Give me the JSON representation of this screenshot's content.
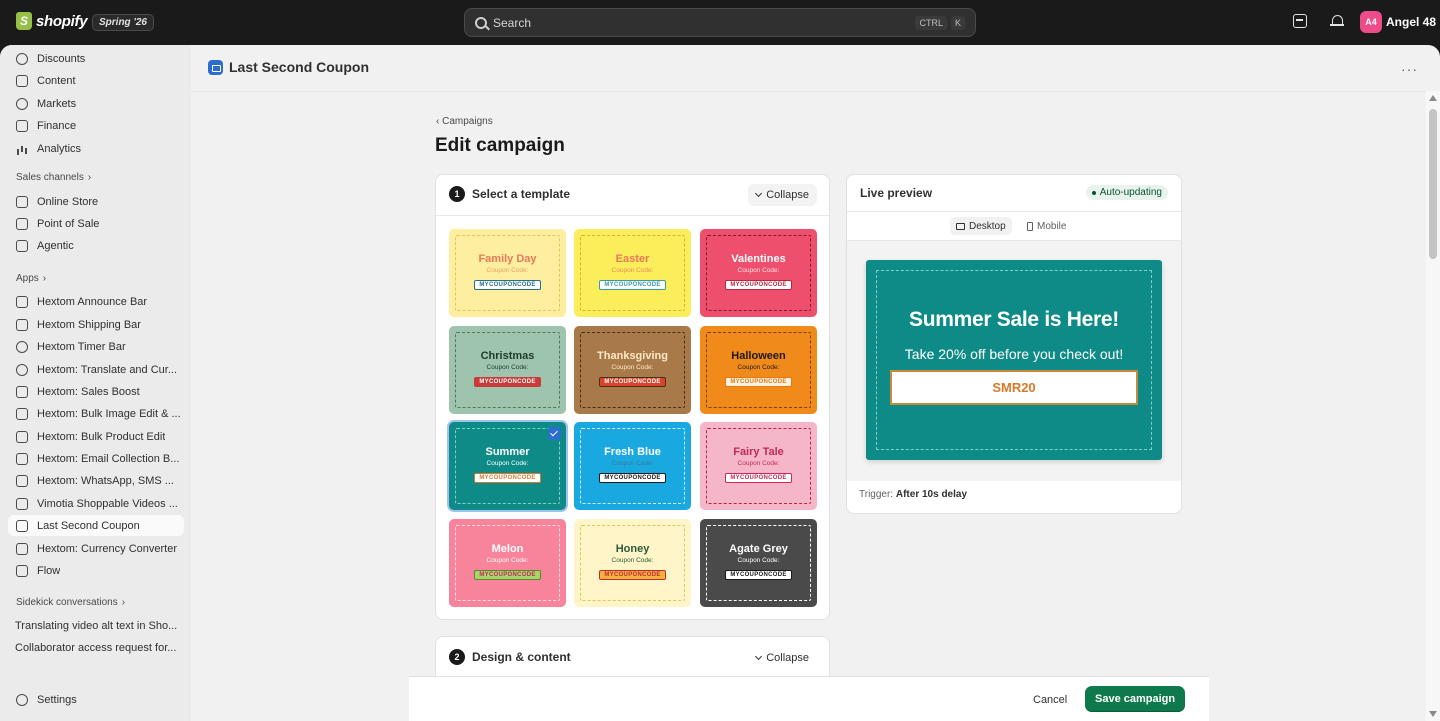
{
  "topbar": {
    "logo_text": "shopify",
    "edition_badge": "Spring '26",
    "search_placeholder": "Search",
    "shortcut_ctrl": "CTRL",
    "shortcut_key": "K",
    "avatar_initials": "A4",
    "user_name": "Angel 48",
    "avatar_color": "#ed4b8a"
  },
  "sidebar": {
    "top_items": [
      {
        "label": "Discounts",
        "icon": "discount-icon"
      },
      {
        "label": "Content",
        "icon": "content-icon"
      },
      {
        "label": "Markets",
        "icon": "globe-icon"
      },
      {
        "label": "Finance",
        "icon": "bank-icon"
      },
      {
        "label": "Analytics",
        "icon": "chart-icon"
      }
    ],
    "sales_channels_label": "Sales channels",
    "sales_channels": [
      {
        "label": "Online Store",
        "icon": "store-icon"
      },
      {
        "label": "Point of Sale",
        "icon": "pos-icon"
      },
      {
        "label": "Agentic",
        "icon": "agentic-icon"
      }
    ],
    "apps_label": "Apps",
    "apps": [
      {
        "label": "Hextom Announce Bar"
      },
      {
        "label": "Hextom Shipping Bar"
      },
      {
        "label": "Hextom Timer Bar"
      },
      {
        "label": "Hextom: Translate and Cur..."
      },
      {
        "label": "Hextom: Sales Boost"
      },
      {
        "label": "Hextom: Bulk Image Edit & ..."
      },
      {
        "label": "Hextom: Bulk Product Edit"
      },
      {
        "label": "Hextom: Email Collection B..."
      },
      {
        "label": "Hextom: WhatsApp, SMS ..."
      },
      {
        "label": "Vimotia Shoppable Videos ..."
      },
      {
        "label": "Last Second Coupon"
      },
      {
        "label": "Hextom: Currency Converter"
      },
      {
        "label": "Flow"
      }
    ],
    "sidekick_label": "Sidekick conversations",
    "sidekick": [
      "Translating video alt text in Sho...",
      "Collaborator access request for..."
    ],
    "settings_label": "Settings"
  },
  "page": {
    "app_title": "Last Second Coupon",
    "more_actions": "···",
    "breadcrumb": "Campaigns",
    "heading": "Edit campaign"
  },
  "template_section": {
    "step": "1",
    "title": "Select a template",
    "collapse_label": "Collapse",
    "templates": [
      {
        "name": "Family Day",
        "sub": "Coupon Code:",
        "code": "MYCOUPONCODE",
        "bg": "#fdeea0",
        "border": "#e0c65a",
        "name_color": "#e8795a",
        "sub_color": "#e8a26a",
        "code_bg": "#ffffff",
        "code_color": "#2a6f8a",
        "code_border": "#2a6f8a"
      },
      {
        "name": "Easter",
        "sub": "Coupon Code:",
        "code": "MYCOUPONCODE",
        "bg": "#fbee5a",
        "border": "#c9b830",
        "name_color": "#e8795a",
        "sub_color": "#e88e5a",
        "code_bg": "#ffffff",
        "code_color": "#3a9aa8",
        "code_border": "#3a9aa8"
      },
      {
        "name": "Valentines",
        "sub": "Coupon Code:",
        "code": "MYCOUPONCODE",
        "bg": "#ee4f6c",
        "border": "#7a1e2e",
        "name_color": "#ffffff",
        "sub_color": "#ffe0e6",
        "code_bg": "#ffffff",
        "code_color": "#b5283f",
        "code_border": "#b5283f"
      },
      {
        "name": "Christmas",
        "sub": "Coupon Code:",
        "code": "MYCOUPONCODE",
        "bg": "#9fc4ae",
        "border": "#4a7a5e",
        "name_color": "#1e3a2a",
        "sub_color": "#1e3a2a",
        "code_bg": "#c93a3a",
        "code_color": "#ffffff",
        "code_border": "#c93a3a"
      },
      {
        "name": "Thanksgiving",
        "sub": "Coupon Code:",
        "code": "MYCOUPONCODE",
        "bg": "#a87a4a",
        "border": "#4a2e14",
        "name_color": "#ffe9c4",
        "sub_color": "#ffe9c4",
        "code_bg": "#d9432b",
        "code_color": "#ffffff",
        "code_border": "#4a2e14"
      },
      {
        "name": "Halloween",
        "sub": "Coupon Code:",
        "code": "MYCOUPONCODE",
        "bg": "#f08a1a",
        "border": "#7a3e05",
        "name_color": "#1a1a1a",
        "sub_color": "#1a1a1a",
        "code_bg": "#fff2e0",
        "code_color": "#e07a14",
        "code_border": "#e07a14"
      },
      {
        "name": "Summer",
        "sub": "Coupon Code:",
        "code": "MYCOUPONCODE",
        "bg": "#0f8b87",
        "border": "#7fd0cc",
        "name_color": "#ffffff",
        "sub_color": "#ffffff",
        "code_bg": "#ffffff",
        "code_color": "#d97a2b",
        "code_border": "#d97a2b",
        "selected": true
      },
      {
        "name": "Fresh Blue",
        "sub": "Coupon Code:",
        "code": "MYCOUPONCODE",
        "bg": "#1aa8e0",
        "border": "#d8f2ff",
        "name_color": "#ffffff",
        "sub_color": "#3a7aa0",
        "code_bg": "#ffffff",
        "code_color": "#1a1a1a",
        "code_border": "#1a1a1a"
      },
      {
        "name": "Fairy Tale",
        "sub": "Coupon Code:",
        "code": "MYCOUPONCODE",
        "bg": "#f6b6c9",
        "border": "#b5283f",
        "name_color": "#c22a5a",
        "sub_color": "#c22a5a",
        "code_bg": "#ffffff",
        "code_color": "#c22a5a",
        "code_border": "#c22a5a"
      },
      {
        "name": "Melon",
        "sub": "Coupon Code:",
        "code": "MYCOUPONCODE",
        "bg": "#f7849a",
        "border": "#ffe0e6",
        "name_color": "#ffffff",
        "sub_color": "#ffffff",
        "code_bg": "#a8d46a",
        "code_color": "#c22a5a",
        "code_border": "#5a8a2a"
      },
      {
        "name": "Honey",
        "sub": "Coupon Code:",
        "code": "MYCOUPONCODE",
        "bg": "#fff5c8",
        "border": "#e0c65a",
        "name_color": "#2a5a3a",
        "sub_color": "#2a5a3a",
        "code_bg": "#f3b23a",
        "code_color": "#c22a3a",
        "code_border": "#c22a3a"
      },
      {
        "name": "Agate Grey",
        "sub": "Coupon Code:",
        "code": "MYCOUPONCODE",
        "bg": "#4a4a4a",
        "border": "#ffffff",
        "name_color": "#ffffff",
        "sub_color": "#ffffff",
        "code_bg": "#ffffff",
        "code_color": "#1a1a1a",
        "code_border": "#1a1a1a"
      }
    ]
  },
  "design_section": {
    "step": "2",
    "title": "Design & content",
    "collapse_label": "Collapse"
  },
  "preview": {
    "title": "Live preview",
    "status_badge": "Auto-updating",
    "tab_desktop": "Desktop",
    "tab_mobile": "Mobile",
    "popup_title": "Summer Sale is Here!",
    "popup_subtitle": "Take 20% off before you check out!",
    "popup_code": "SMR20",
    "trigger_label": "Trigger:",
    "trigger_value": "After 10s delay"
  },
  "footer": {
    "cancel_label": "Cancel",
    "save_label": "Save campaign",
    "save_color": "#0e7a4c"
  }
}
